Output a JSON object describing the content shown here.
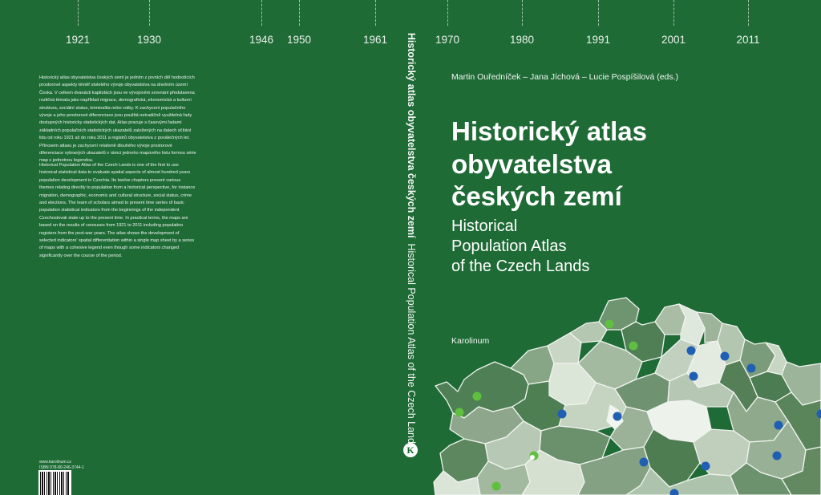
{
  "timeline": {
    "years": [
      "1921",
      "1930",
      "1946",
      "1950",
      "1961",
      "1970",
      "1980",
      "1991",
      "2001",
      "2011"
    ]
  },
  "back": {
    "text_cz": "Historický atlas obyvatelstva českých zemí je jedním z prvních děl hodnotících prostorové aspekty téměř stoletého vývoje obyvatelstva na dnešním území Česka. V celkem dvanácti kapitolách jsou ve vývojovém srovnání představena rozličná témata jako například migrace, demografická, ekonomická a kulturní struktura, sociální status, kriminalita nebo volby. K zachycení populačního vývoje a jeho prostorové diferenciace jsou použitá netradičně využitelná řady dostupných historicky statistických dat. Atlas pracuje s časovými řadami základních populačních statistických ukazatelů založených na datech sčítání lidu od roku 1921 až do roku 2011 a registrů obyvatelstva z poválečných let. Přínosem atlasu je zachycení relativně dlouhého vývoje prostorové diferenciace vybraných ukazatelů v rámci jednoho mapového listu formou série map s jednotnou legendou.",
    "text_en": "Historical Population Atlas of the Czech Lands is one of the first to use historical statistical data to evaluate spatial aspects of almost hundred years population development in Czechia. Its twelve chapters present various themes relating directly to population from a historical perspective, for instance migration, demographic, economic and cultural structure, social status, crime and elections. The team of scholars aimed to present time series of basic population statistical indicators from the beginnings of the independent Czechoslovak state up to the present time. In practical terms, the maps are based on the results of censuses from 1921 to 2011 including population registers from the post-war years. The atlas shows the development of selected indicators' spatial differentiation within a single map sheet by a series of maps with a cohesive legend even though some indicators changed significantly over the course of the period.",
    "website": "www.karolinum.cz",
    "isbn": "ISBN 978-80-246-3744-1"
  },
  "spine": {
    "title_cz": "Historický atlas obyvatelstva českých zemí",
    "title_en": "Historical Population Atlas of the Czech Lands",
    "logo_letter": "K"
  },
  "front": {
    "authors": "Martin Ouředníček – Jana Jíchová – Lucie Pospíšilová (eds.)",
    "title_cz_lines": [
      "Historický atlas",
      "obyvatelstva",
      "českých zemí"
    ],
    "title_en_lines": [
      "Historical",
      "Population Atlas",
      "of the Czech Lands"
    ],
    "publisher": "Karolinum"
  },
  "colors": {
    "background": "#1f6b36",
    "text": "#ffffff",
    "dot_green": "#5fbf3f",
    "dot_blue": "#1f5fb4"
  }
}
